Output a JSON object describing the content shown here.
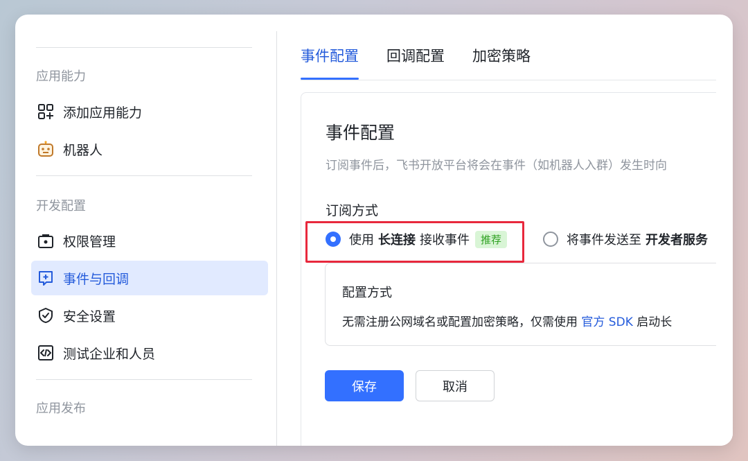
{
  "sidebar": {
    "sections": [
      {
        "title": "应用能力"
      },
      {
        "title": "开发配置"
      },
      {
        "title": "应用发布"
      }
    ],
    "items": [
      {
        "label": "添加应用能力",
        "icon": "grid-plus-icon"
      },
      {
        "label": "机器人",
        "icon": "robot-icon"
      },
      {
        "label": "权限管理",
        "icon": "lock-box-icon"
      },
      {
        "label": "事件与回调",
        "icon": "event-callback-icon"
      },
      {
        "label": "安全设置",
        "icon": "shield-check-icon"
      },
      {
        "label": "测试企业和人员",
        "icon": "code-box-icon"
      }
    ],
    "active_item": "事件与回调"
  },
  "tabs": [
    {
      "label": "事件配置"
    },
    {
      "label": "回调配置"
    },
    {
      "label": "加密策略"
    }
  ],
  "card": {
    "title": "事件配置",
    "description": "订阅事件后，飞书开放平台将会在事件（如机器人入群）发生时向",
    "subscription_label": "订阅方式",
    "option1": {
      "prefix": "使用",
      "bold": "长连接",
      "suffix": "接收事件",
      "badge": "推荐"
    },
    "option2": {
      "prefix": "将事件发送至",
      "bold": "开发者服务"
    },
    "config_box": {
      "title": "配置方式",
      "text_prefix": "无需注册公网域名或配置加密策略，仅需使用",
      "link": "官方 SDK",
      "text_suffix": "启动长"
    },
    "save_label": "保存",
    "cancel_label": "取消"
  },
  "colors": {
    "accent": "#3370ff",
    "highlight_border": "#e8283c",
    "badge_bg": "#d9f5d6",
    "badge_text": "#2ea121"
  }
}
